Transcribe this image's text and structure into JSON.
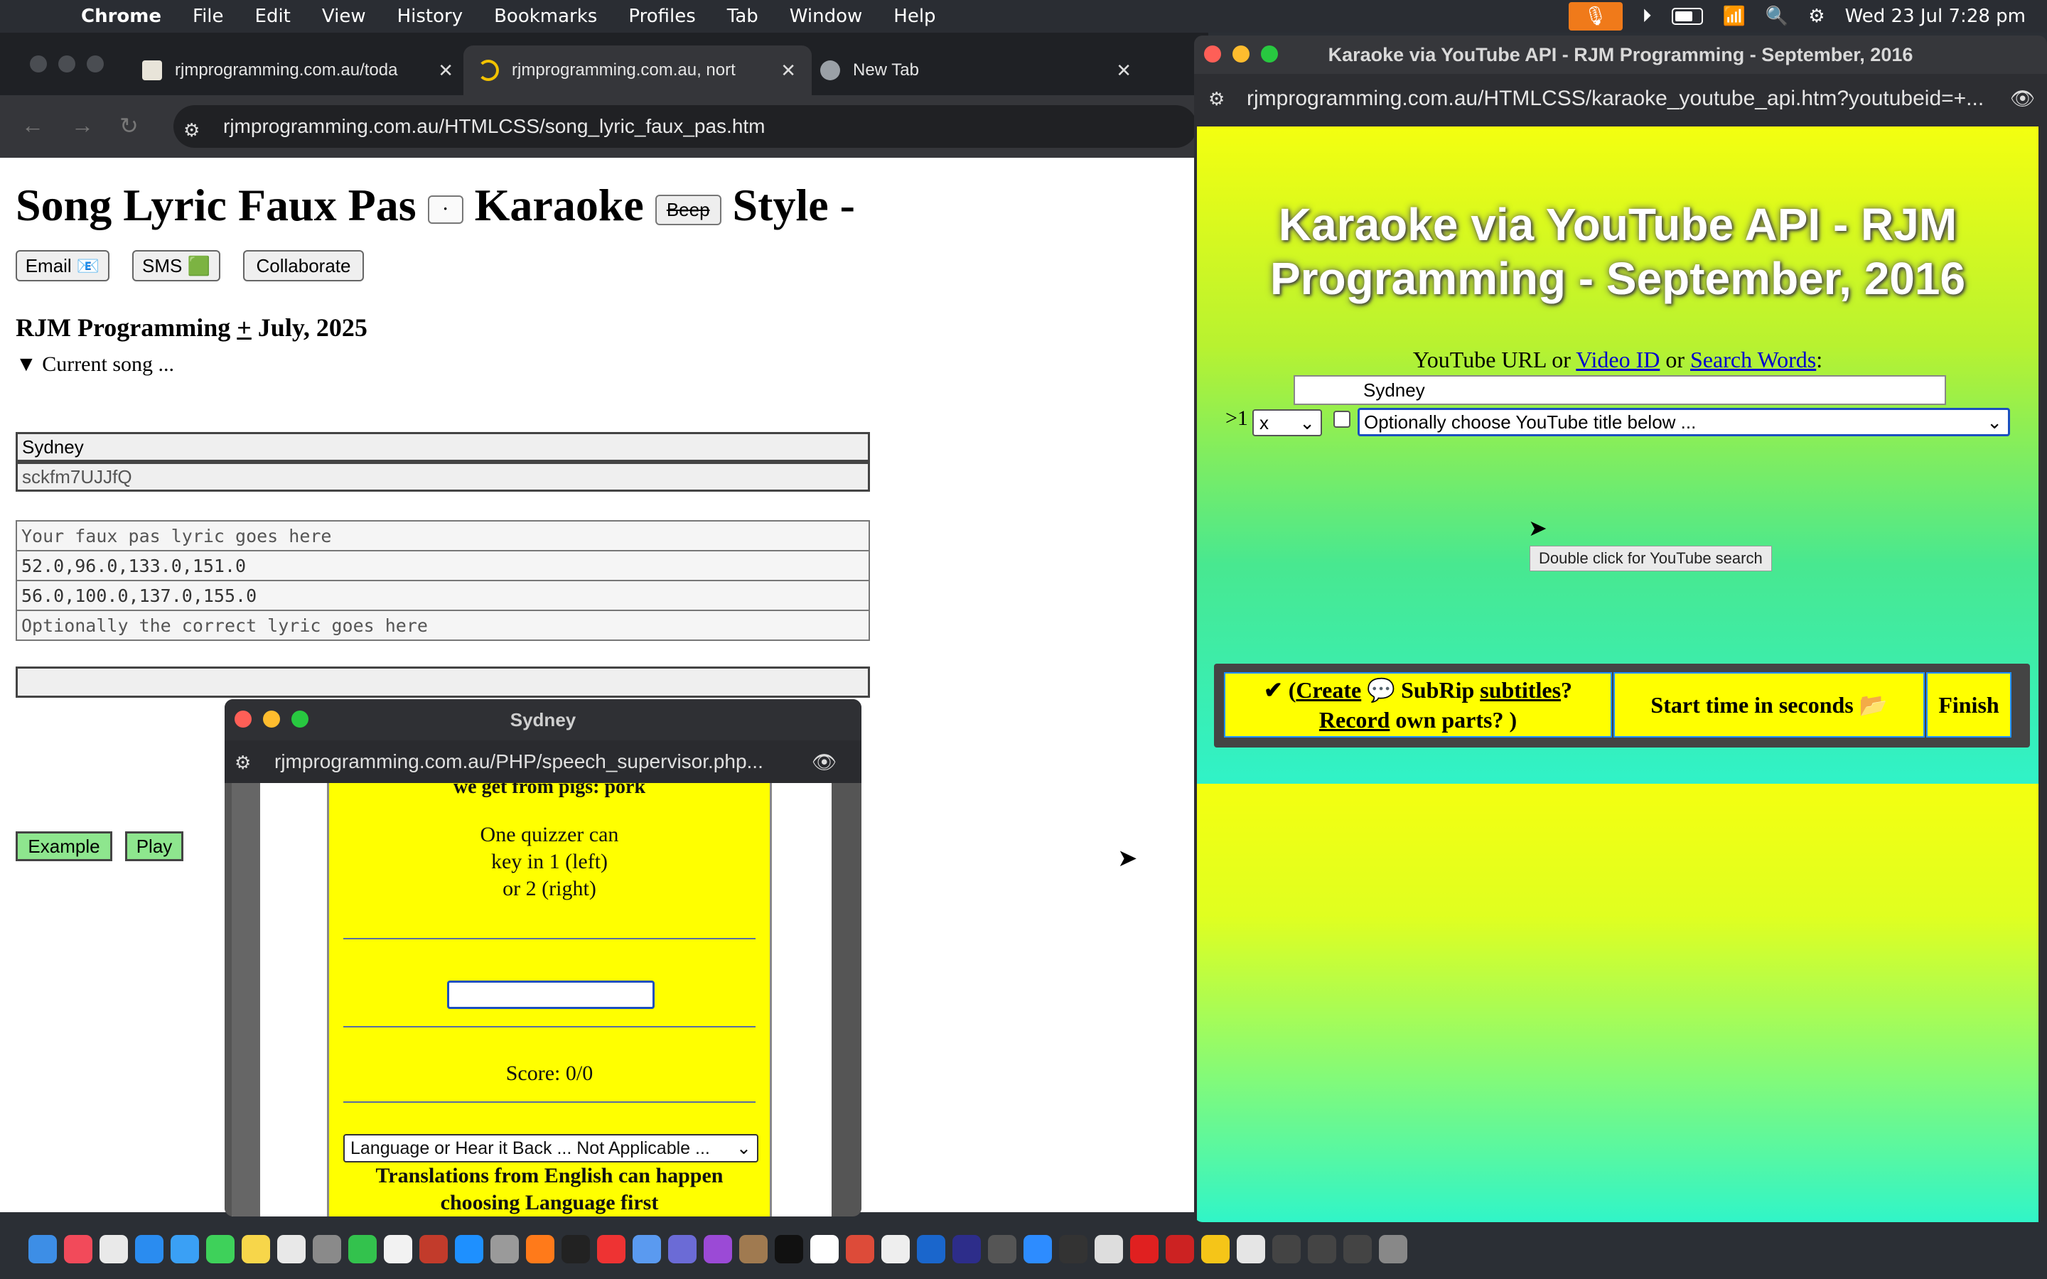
{
  "menubar": {
    "app": "Chrome",
    "items": [
      "File",
      "Edit",
      "View",
      "History",
      "Bookmarks",
      "Profiles",
      "Tab",
      "Window",
      "Help"
    ],
    "clock": "Wed 23 Jul  7:28 pm"
  },
  "main_window": {
    "tabs": [
      {
        "title": "rjmprogramming.com.au/toda"
      },
      {
        "title": "rjmprogramming.com.au, nort"
      },
      {
        "title": "New Tab"
      }
    ],
    "url": "rjmprogramming.com.au/HTMLCSS/song_lyric_faux_pas.htm",
    "page": {
      "title_part1": "Song Lyric Faux Pas",
      "dropdown": "·",
      "title_part2": "Karaoke",
      "beep": "Beep",
      "title_part3": "Style -",
      "buttons": {
        "email": "Email 📧",
        "sms": "SMS 🟩",
        "collaborate": "Collaborate"
      },
      "subheading_a": "RJM Programming",
      "subheading_pm": "+",
      "subheading_b": "July, 2025",
      "details_summary": "▼ Current song ...",
      "song": "Sydney",
      "video_id": "sckfm7UJJfQ",
      "lyric_placeholder": "Your faux pas lyric goes here",
      "times_start": "52.0,96.0,133.0,151.0",
      "times_end": "56.0,100.0,137.0,155.0",
      "correct_placeholder": "Optionally the correct lyric goes here",
      "example": "Example",
      "play": "Play"
    }
  },
  "sydney_window": {
    "title": "Sydney",
    "url": "rjmprogramming.com.au/PHP/speech_supervisor.php...",
    "top_text": "we get from pigs: pork",
    "quiz_text_1": "One quizzer can",
    "quiz_text_2": "key in 1 (left)",
    "quiz_text_3": "or 2 (right)",
    "score": "Score: 0/0",
    "language_select": "Language or Hear it Back ... Not Applicable ...",
    "translations_1": "Translations from English can happen",
    "translations_2": "choosing Language first"
  },
  "karaoke_window": {
    "title": "Karaoke via YouTube API - RJM Programming - September, 2016",
    "url": "rjmprogramming.com.au/HTMLCSS/karaoke_youtube_api.htm?youtubeid=+...",
    "heading": "Karaoke via YouTube API - RJM Programming - September, 2016",
    "label_a": "YouTube URL or",
    "link_video_id": "Video ID",
    "label_or": "or",
    "link_search": "Search Words",
    "label_colon": ":",
    "input_value": "Sydney",
    "row_prefix": ">1",
    "x_select": "x",
    "title_select": "Optionally choose YouTube title below ...",
    "tooltip": "Double click for YouTube search",
    "cell1_a": "✔ (",
    "cell1_create": "Create",
    "cell1_b": " 💬 SubRip ",
    "cell1_subtitles": "subtitles",
    "cell1_c": "?",
    "cell1_record": "Record",
    "cell1_d": " own parts?      )",
    "cell2": "Start time in seconds 📂",
    "cell3": "Finish"
  }
}
